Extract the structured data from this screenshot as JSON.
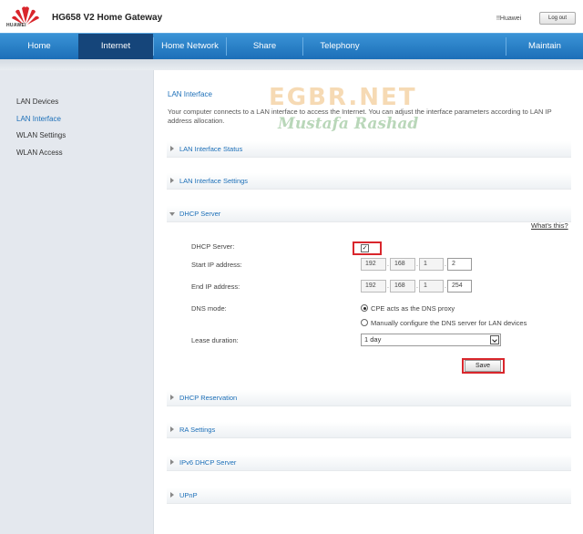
{
  "header": {
    "brand": "HUAWEI",
    "title": "HG658 V2 Home Gateway",
    "user": "!!Huawei",
    "logout_label": "Log out"
  },
  "nav": {
    "items": [
      {
        "label": "Home"
      },
      {
        "label": "Internet"
      },
      {
        "label": "Home Network"
      },
      {
        "label": "Share"
      },
      {
        "label": "Telephony"
      },
      {
        "label": "Maintain"
      }
    ],
    "active": "Internet",
    "colors": {
      "bar": "#2a82c8",
      "active": "#15457a"
    }
  },
  "sidebar": {
    "items": [
      {
        "label": "LAN Devices"
      },
      {
        "label": "LAN Interface"
      },
      {
        "label": "WLAN Settings"
      },
      {
        "label": "WLAN Access"
      }
    ],
    "active": "LAN Interface"
  },
  "main": {
    "title": "LAN Interface",
    "description": "Your computer connects to a LAN interface to access the Internet. You can adjust the interface parameters according to LAN IP address allocation.",
    "sections": [
      {
        "label": "LAN Interface Status",
        "expanded": false
      },
      {
        "label": "LAN Interface Settings",
        "expanded": false
      },
      {
        "label": "DHCP Server",
        "expanded": true
      },
      {
        "label": "DHCP Reservation",
        "expanded": false
      },
      {
        "label": "RA Settings",
        "expanded": false
      },
      {
        "label": "IPv6 DHCP Server",
        "expanded": false
      },
      {
        "label": "UPnP",
        "expanded": false
      }
    ],
    "whats_this": "What's this?"
  },
  "dhcp": {
    "server_label": "DHCP Server:",
    "server_enabled": true,
    "check_mark": "✓",
    "start_ip_label": "Start IP address:",
    "start_ip": [
      "192",
      "168",
      "1",
      "2"
    ],
    "end_ip_label": "End IP address:",
    "end_ip": [
      "192",
      "168",
      "1",
      "254"
    ],
    "dns_label": "DNS mode:",
    "dns_options": [
      "CPE acts as the DNS proxy",
      "Manually configure the DNS server for LAN devices"
    ],
    "dns_selected": 0,
    "lease_label": "Lease duration:",
    "lease_value": "1 day",
    "save_label": "Save",
    "highlight_color": "#d9262c"
  },
  "watermark": {
    "line1": "EGBR.NET",
    "line2": "Mustafa Rashad"
  }
}
